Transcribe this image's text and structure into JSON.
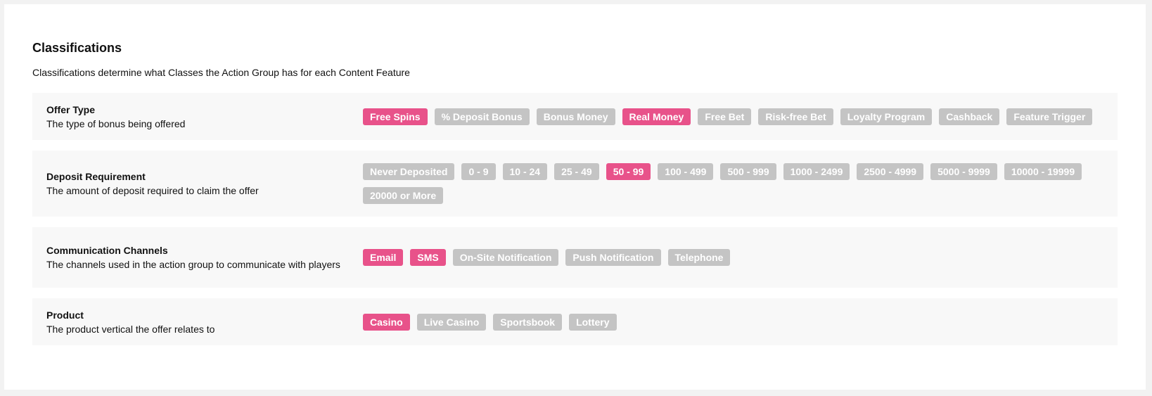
{
  "header": {
    "title": "Classifications",
    "subtitle": "Classifications determine what Classes the Action Group has for each Content Feature"
  },
  "colors": {
    "selected": "#e8528a",
    "unselected": "#c4c4c4"
  },
  "sections": [
    {
      "id": "offer-type",
      "title": "Offer Type",
      "description": "The type of bonus being offered",
      "tags": [
        {
          "label": "Free Spins",
          "selected": true
        },
        {
          "label": "% Deposit Bonus",
          "selected": false
        },
        {
          "label": "Bonus Money",
          "selected": false
        },
        {
          "label": "Real Money",
          "selected": true
        },
        {
          "label": "Free Bet",
          "selected": false
        },
        {
          "label": "Risk-free Bet",
          "selected": false
        },
        {
          "label": "Loyalty Program",
          "selected": false
        },
        {
          "label": "Cashback",
          "selected": false
        },
        {
          "label": "Feature Trigger",
          "selected": false
        }
      ]
    },
    {
      "id": "deposit-requirement",
      "title": "Deposit Requirement",
      "description": "The amount of deposit required to claim the offer",
      "tags": [
        {
          "label": "Never Deposited",
          "selected": false
        },
        {
          "label": "0 - 9",
          "selected": false
        },
        {
          "label": "10 - 24",
          "selected": false
        },
        {
          "label": "25 - 49",
          "selected": false
        },
        {
          "label": "50 - 99",
          "selected": true
        },
        {
          "label": "100 - 499",
          "selected": false
        },
        {
          "label": "500 - 999",
          "selected": false
        },
        {
          "label": "1000 - 2499",
          "selected": false
        },
        {
          "label": "2500 - 4999",
          "selected": false
        },
        {
          "label": "5000 - 9999",
          "selected": false
        },
        {
          "label": "10000 - 19999",
          "selected": false
        },
        {
          "label": "20000 or More",
          "selected": false
        }
      ]
    },
    {
      "id": "communication-channels",
      "title": "Communication Channels",
      "description": "The channels used in the action group to communicate with players",
      "tags": [
        {
          "label": "Email",
          "selected": true
        },
        {
          "label": "SMS",
          "selected": true
        },
        {
          "label": "On-Site Notification",
          "selected": false
        },
        {
          "label": "Push Notification",
          "selected": false
        },
        {
          "label": "Telephone",
          "selected": false
        }
      ]
    },
    {
      "id": "product",
      "title": "Product",
      "description": "The product vertical the offer relates to",
      "tags": [
        {
          "label": "Casino",
          "selected": true
        },
        {
          "label": "Live Casino",
          "selected": false
        },
        {
          "label": "Sportsbook",
          "selected": false
        },
        {
          "label": "Lottery",
          "selected": false
        }
      ]
    }
  ]
}
